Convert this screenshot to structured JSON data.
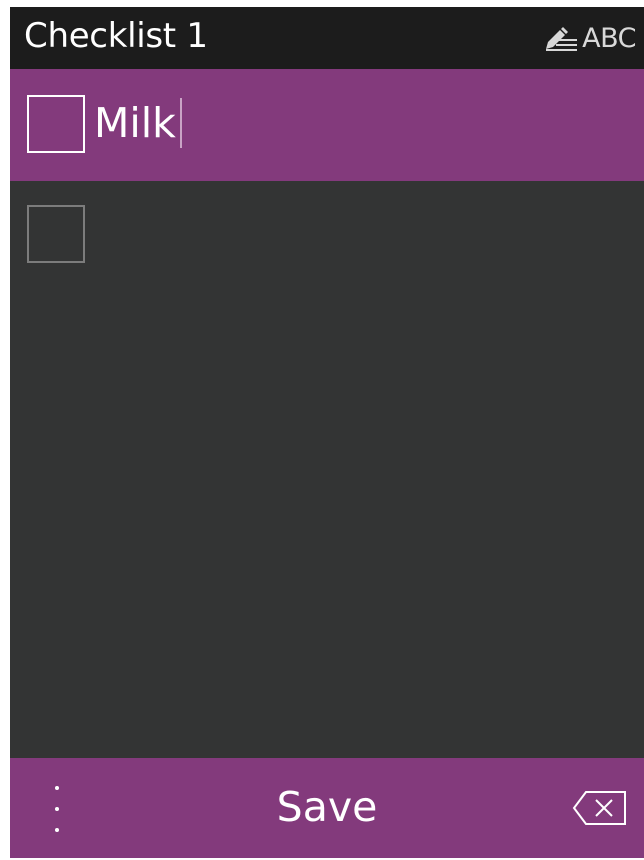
{
  "header": {
    "title": "Checklist 1",
    "input_mode_icon": "pencil-lines-icon",
    "input_mode_label": "ABC"
  },
  "checklist": {
    "items": [
      {
        "text": "Milk",
        "checked": false,
        "active": true
      },
      {
        "text": "",
        "checked": false,
        "active": false
      }
    ]
  },
  "softkeys": {
    "left_icon": "vertical-dots-icon",
    "center_label": "Save",
    "right_icon": "backspace-icon"
  },
  "colors": {
    "accent": "#833a7c",
    "header_bg": "#1c1c1c",
    "content_bg": "#333434"
  }
}
